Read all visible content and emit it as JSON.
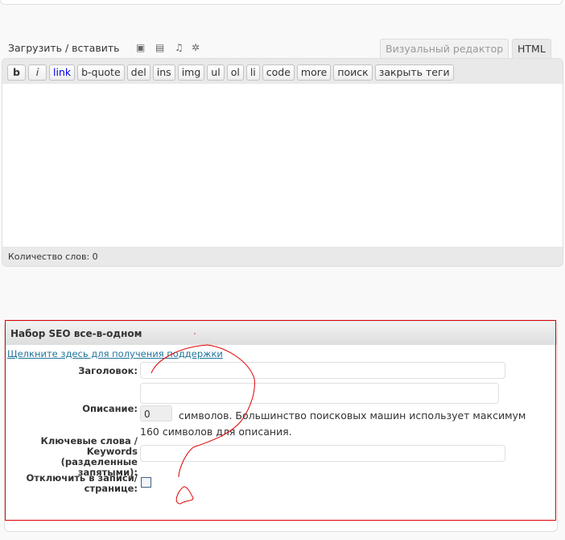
{
  "editor": {
    "upload_label": "Загрузить / вставить",
    "media_icons": [
      "image-icon",
      "video-icon",
      "audio-icon",
      "media-icon"
    ],
    "tabs": [
      {
        "label": "Визуальный редактор",
        "active": false
      },
      {
        "label": "HTML",
        "active": true
      }
    ],
    "buttons": [
      "b",
      "i",
      "link",
      "b-quote",
      "del",
      "ins",
      "img",
      "ul",
      "ol",
      "li",
      "code",
      "more",
      "поиск",
      "закрыть теги"
    ],
    "word_count": "Количество слов: 0",
    "link_color": "#0000ee"
  },
  "seo": {
    "title": "Набор SEO все-в-одном",
    "support_link": "Щелкните здесь для получения поддержки",
    "title_label": "Заголовок:",
    "description_label": "Описание:",
    "char_count": "0",
    "char_hint": "символов. Большинство поисковых машин использует максимум 160 символов для описания.",
    "keywords_label": "Ключевые слова / Keywords (разделенные запятыми):",
    "disable_label": "Отключить в записи/ странице:",
    "disable_checked": false
  },
  "annotation_color": "#e00000"
}
